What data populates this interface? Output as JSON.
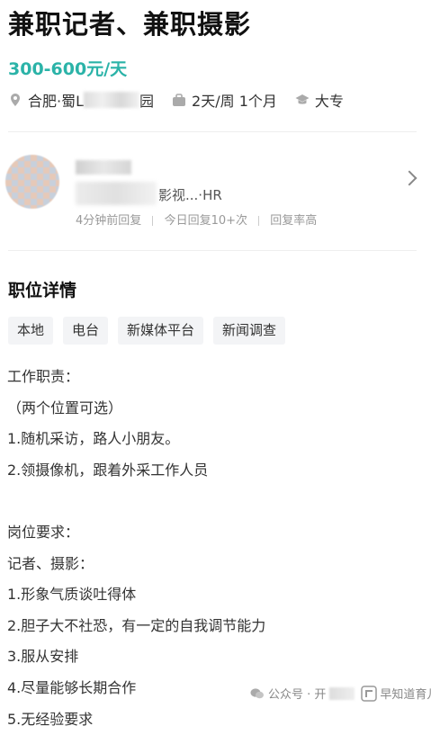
{
  "job": {
    "title": "兼职记者、兼职摄影",
    "salary": "300-600元/天",
    "location": "合肥·蜀L",
    "location_suffix": "园",
    "schedule": "2天/周 1个月",
    "education": "大专"
  },
  "recruiter": {
    "company_role": "影视...·HR",
    "activity": [
      "4分钟前回复",
      "今日回复10+次",
      "回复率高"
    ]
  },
  "details": {
    "heading": "职位详情",
    "tags": [
      "本地",
      "电台",
      "新媒体平台",
      "新闻调查"
    ],
    "lines": [
      "工作职责：",
      "（两个位置可选）",
      "1.随机采访，路人小朋友。",
      "2.领摄像机，跟着外采工作人员",
      "",
      "岗位要求：",
      "记者、摄影：",
      "1.形象气质谈吐得体",
      "2.胆子大不社恐，有一定的自我调节能力",
      "3.服从安排",
      "4.尽量能够长期合作",
      "5.无经验要求"
    ]
  },
  "watermark": {
    "prefix": "公众号 · 开",
    "suffix": "早知道育儿网"
  },
  "icons": {
    "location": "location-pin-icon",
    "schedule": "briefcase-icon",
    "education": "graduation-cap-icon",
    "chevron": "chevron-right-icon",
    "wechat": "wechat-icon"
  },
  "colors": {
    "accent": "#2bb3a8",
    "tag_bg": "#f3f4f6",
    "muted": "#999999"
  }
}
